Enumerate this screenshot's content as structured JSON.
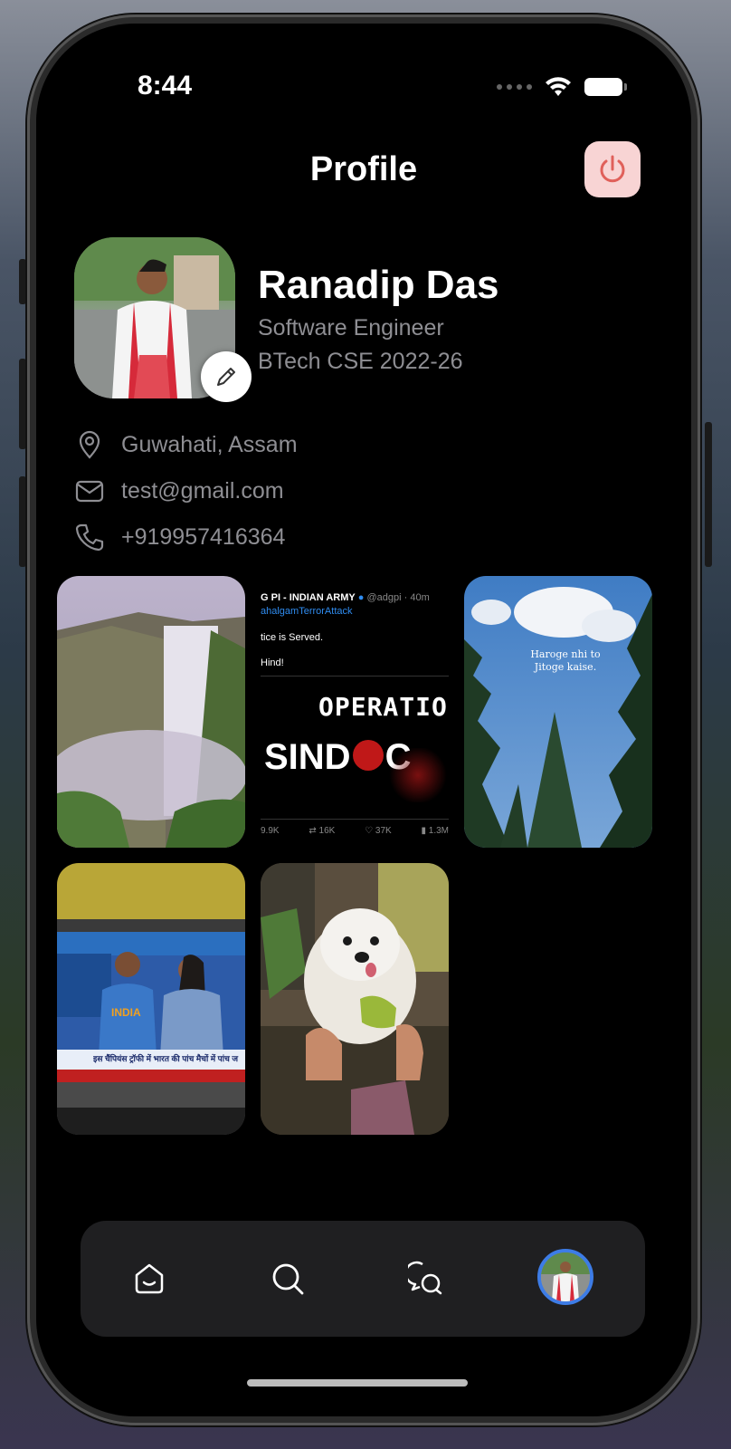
{
  "status": {
    "time": "8:44"
  },
  "header": {
    "title": "Profile"
  },
  "profile": {
    "name": "Ranadip Das",
    "role": "Software Engineer",
    "education": "BTech CSE 2022-26",
    "location": "Guwahati, Assam",
    "email": "test@gmail.com",
    "phone": "+919957416364"
  },
  "posts": {
    "tweet": {
      "account": "G PI - INDIAN ARMY",
      "handle": "@adgpi · 40m",
      "hashtag": "ahalgamTerrorAttack",
      "line1": "tice is Served.",
      "line2": "Hind!",
      "headline1": "OPERATION",
      "headline2": "SIND",
      "headline3": "C",
      "stat1": "9.9K",
      "stat2": "16K",
      "stat3": "37K",
      "stat4": "1.3M"
    },
    "sky_quote": "Haroge nhi to Jitoge kaise.",
    "tv_banner": "इस चैंपियंस ट्रॉफी में भारत की पांच मैचों में पांच ज",
    "tv_jersey": "INDIA"
  },
  "icons": {
    "logout": "power-icon",
    "edit": "pencil-icon",
    "location": "location-pin-icon",
    "email": "mail-icon",
    "phone": "phone-icon",
    "tabs": [
      "home-icon",
      "search-icon",
      "chat-icon",
      "profile-avatar"
    ]
  },
  "colors": {
    "background": "#000000",
    "logout_bg": "#f8d4d4",
    "logout_icon": "#e0605a",
    "secondary_text": "#8e8e93",
    "tabbar_bg": "#1f1f21",
    "active_tab_ring": "#3d7ce6"
  }
}
